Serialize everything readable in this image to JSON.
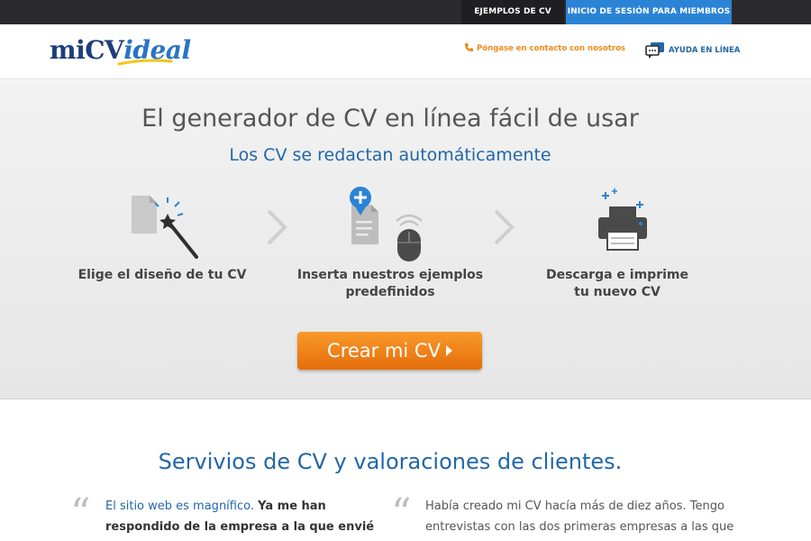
{
  "topbar": {
    "examples_label": "EJEMPLOS DE CV",
    "login_label": "INICIO DE SESIÓN PARA MIEMBROS"
  },
  "header": {
    "logo_main": "miCV",
    "logo_accent": "ideal",
    "contact_label": "Póngase en contacto con nosotros",
    "help_label": "AYUDA EN LÍNEA"
  },
  "hero": {
    "title": "El generador de CV en línea fácil de usar",
    "subtitle": "Los CV se redactan automáticamente",
    "steps": [
      {
        "line1": "Elige el diseño de tu CV",
        "line2": ""
      },
      {
        "line1": "Inserta nuestros ejemplos",
        "line2": "predefinidos"
      },
      {
        "line1": "Descarga e imprime",
        "line2": "tu nuevo CV"
      }
    ],
    "cta_label": "Crear mi CV"
  },
  "services": {
    "title": "Servivios de CV y valoraciones de clientes.",
    "testimonials": [
      {
        "highlight": "El sitio web es magnífico.",
        "bold": "Ya me han",
        "line2": "respondido de la empresa a la que envié la"
      },
      {
        "line1": "Había creado mi CV hacía más de diez años. Tengo",
        "line2": "entrevistas con las dos primeras empresas a las que"
      }
    ]
  },
  "colors": {
    "accent_blue": "#2267a9",
    "cta_orange": "#f08a1c",
    "topbar_dark": "#2b2b2d",
    "login_blue": "#2b83d6"
  }
}
